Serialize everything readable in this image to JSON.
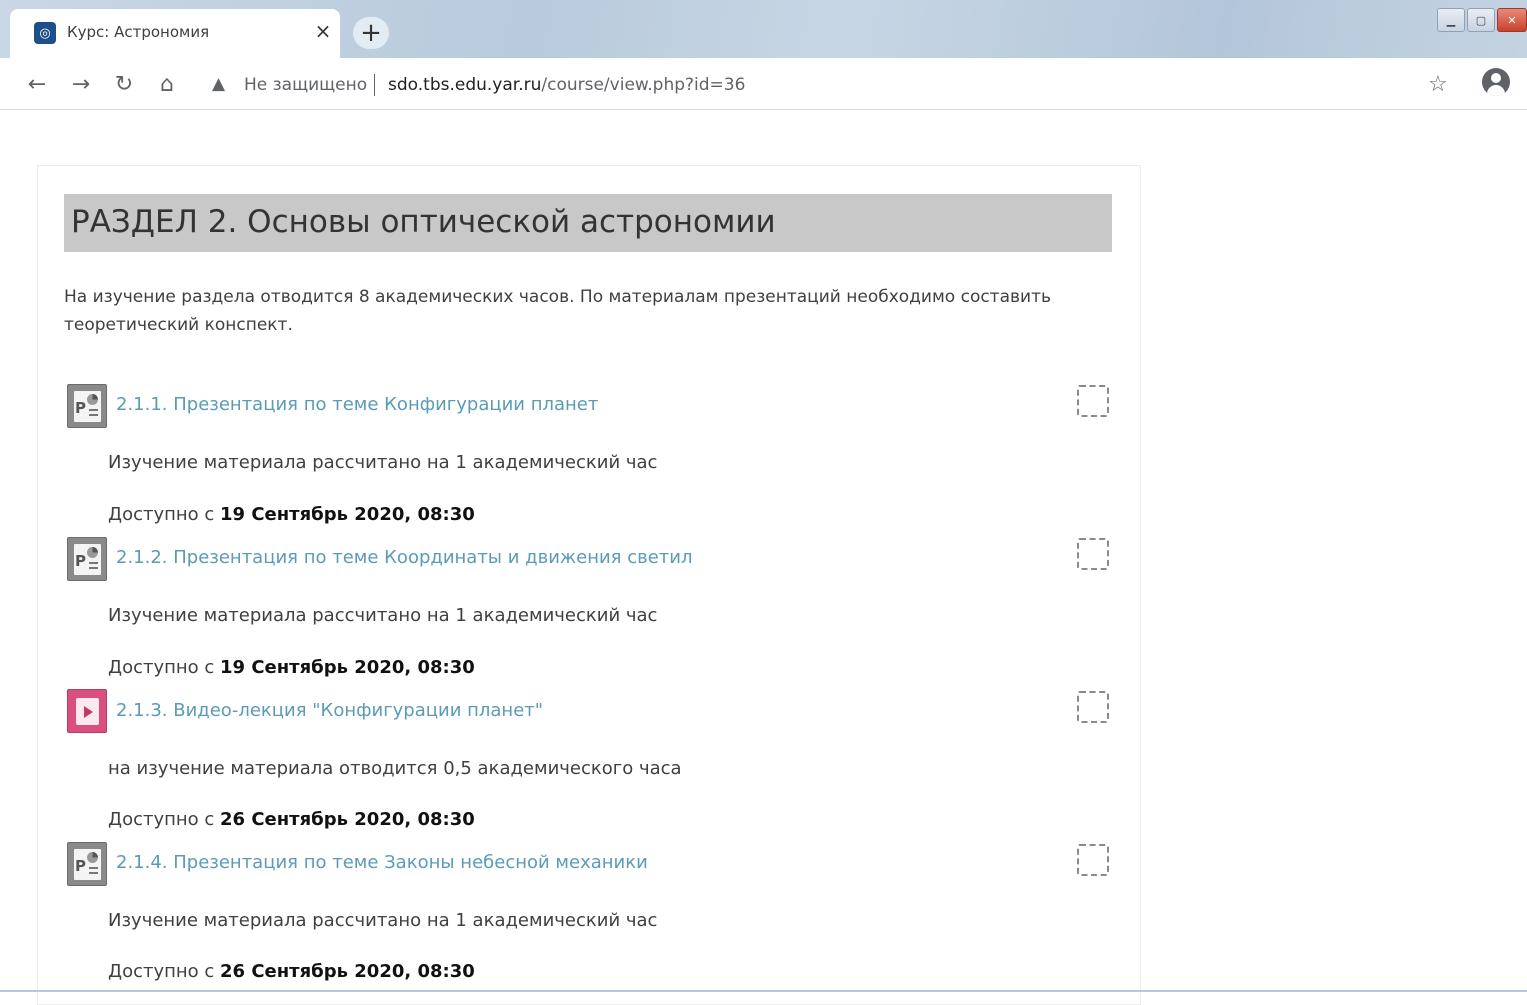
{
  "browser": {
    "tab_title": "Курс: Астрономия",
    "tab_close": "×",
    "new_tab": "+",
    "security_label": "Не защищено",
    "url_host": "sdo.tbs.edu.yar.ru",
    "url_path": "/course/view.php?id=36"
  },
  "section": {
    "title": "РАЗДЕЛ 2. Основы оптической астрономии",
    "summary": "На изучение раздела отводится 8 академических часов. По материалам презентаций необходимо составить теоретический конспект."
  },
  "activities": [
    {
      "type": "presentation",
      "link": "2.1.1. Презентация по теме Конфигурации планет",
      "description": "Изучение материала рассчитано на 1 академический час",
      "available_prefix": "Доступно с",
      "available_date": "19 Сентябрь 2020, 08:30"
    },
    {
      "type": "presentation",
      "link": "2.1.2. Презентация по теме Координаты и движения светил",
      "description": "Изучение материала рассчитано на 1 академический час",
      "available_prefix": "Доступно с",
      "available_date": "19 Сентябрь 2020, 08:30"
    },
    {
      "type": "video",
      "link": "2.1.3. Видео-лекция \"Конфигурации планет\"",
      "description": "на изучение материала отводится 0,5 академического часа",
      "available_prefix": "Доступно с",
      "available_date": "26 Сентябрь 2020, 08:30"
    },
    {
      "type": "presentation",
      "link": "2.1.4. Презентация по теме Законы небесной механики",
      "description": "Изучение материала рассчитано на 1 академический час",
      "available_prefix": "Доступно с",
      "available_date": "26 Сентябрь 2020, 08:30"
    }
  ],
  "colors": {
    "link": "#5b9bb5",
    "section_header_bg": "#c8c8c8",
    "video_icon": "#d94f7e"
  }
}
